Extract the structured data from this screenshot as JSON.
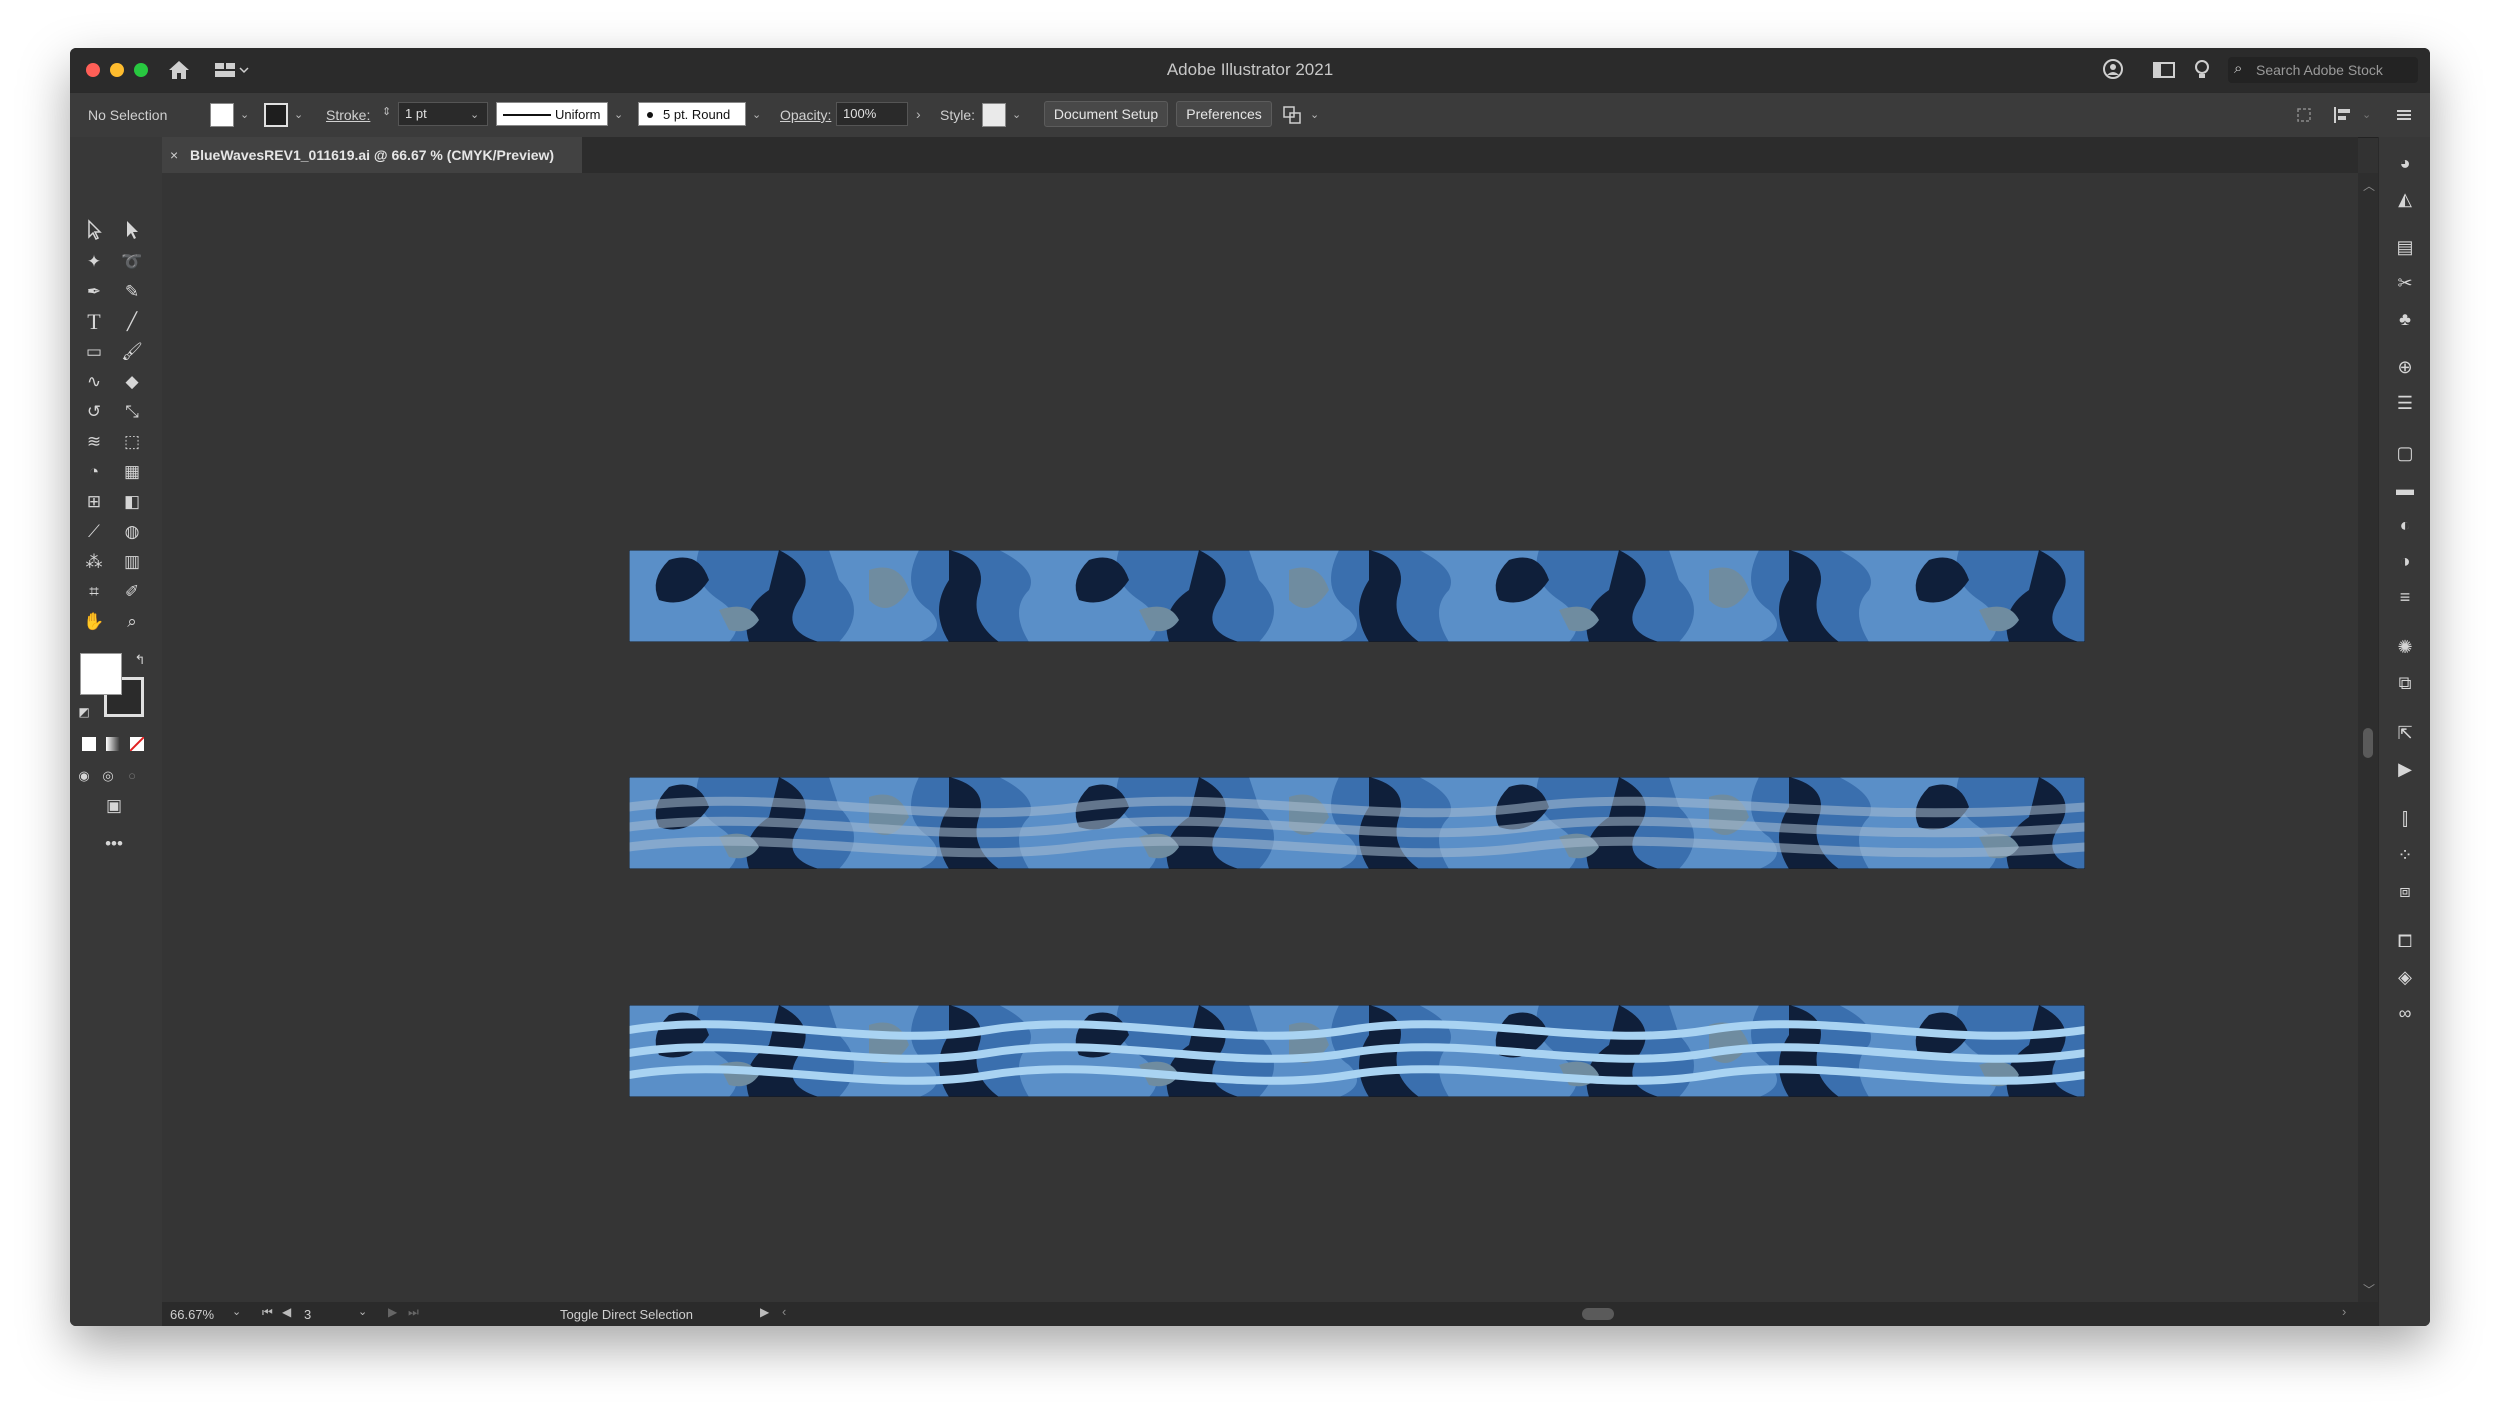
{
  "window": {
    "title": "Adobe Illustrator 2021"
  },
  "titlebar": {
    "search_placeholder": "Search Adobe Stock"
  },
  "control_bar": {
    "selection": "No Selection",
    "stroke_label": "Stroke:",
    "stroke_weight": "1 pt",
    "stroke_profile": "Uniform",
    "brush": "5 pt. Round",
    "opacity_label": "Opacity:",
    "opacity_value": "100%",
    "style_label": "Style:",
    "document_setup": "Document Setup",
    "preferences": "Preferences"
  },
  "document_tab": {
    "label": "BlueWavesREV1_011619.ai @ 66.67 % (CMYK/Preview)"
  },
  "status_bar": {
    "zoom": "66.67%",
    "artboard_number": "3",
    "status_text": "Toggle Direct Selection"
  },
  "colors": {
    "camo_dark": "#0f1f3a",
    "camo_mid": "#3a6fae",
    "camo_light": "#5a8fc8",
    "camo_grey": "#6f8ca0",
    "wave": "#a9d3f2",
    "accent_red": "#ff5f57"
  }
}
